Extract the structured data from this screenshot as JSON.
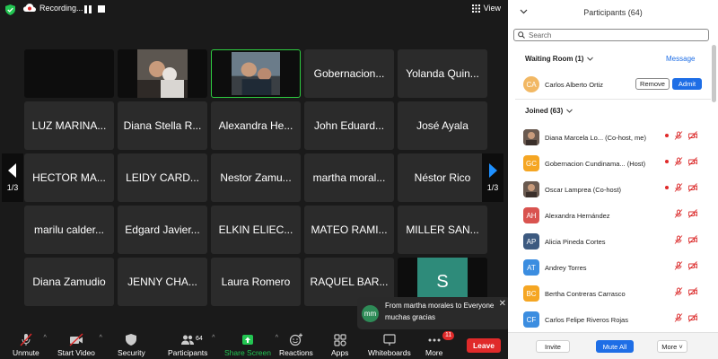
{
  "topbar": {
    "recording_label": "Recording...",
    "view_label": "View"
  },
  "tiles": [
    {
      "type": "dark",
      "name": ""
    },
    {
      "type": "photo",
      "name": ""
    },
    {
      "type": "photo-active",
      "name": ""
    },
    {
      "type": "name",
      "name": "Gobernacion..."
    },
    {
      "type": "name",
      "name": "Yolanda Quin..."
    },
    {
      "type": "name",
      "name": "LUZ MARINA..."
    },
    {
      "type": "name",
      "name": "Diana Stella R..."
    },
    {
      "type": "name",
      "name": "Alexandra He..."
    },
    {
      "type": "name",
      "name": "John Eduard..."
    },
    {
      "type": "name",
      "name": "José Ayala"
    },
    {
      "type": "name",
      "name": "HECTOR MA..."
    },
    {
      "type": "name",
      "name": "LEIDY CARD..."
    },
    {
      "type": "name",
      "name": "Nestor Zamu..."
    },
    {
      "type": "name",
      "name": "martha moral..."
    },
    {
      "type": "name",
      "name": "Néstor Rico"
    },
    {
      "type": "name",
      "name": "marilu calder..."
    },
    {
      "type": "name",
      "name": "Edgard Javier..."
    },
    {
      "type": "name",
      "name": "ELKIN ELIEC..."
    },
    {
      "type": "name",
      "name": "MATEO RAMI..."
    },
    {
      "type": "name",
      "name": "MILLER SAN..."
    },
    {
      "type": "name",
      "name": "Diana Zamudio"
    },
    {
      "type": "name",
      "name": "JENNY CHA..."
    },
    {
      "type": "name",
      "name": "Laura Romero"
    },
    {
      "type": "name",
      "name": "RAQUEL BAR..."
    },
    {
      "type": "letter",
      "name": "S",
      "color": "#2e8b7a"
    }
  ],
  "pager": {
    "left_label": "1/3",
    "right_label": "1/3",
    "arrow_color": "#1e90ff"
  },
  "toast": {
    "avatar_initials": "mm",
    "title": "From martha morales to Everyone",
    "message": "muchas gracias"
  },
  "toolbar": {
    "unmute": "Unmute",
    "start_video": "Start Video",
    "security": "Security",
    "participants": "Participants",
    "participants_count": "64",
    "share_screen": "Share Screen",
    "reactions": "Reactions",
    "apps": "Apps",
    "whiteboards": "Whiteboards",
    "more": "More",
    "more_badge": "11",
    "leave": "Leave"
  },
  "panel": {
    "title": "Participants (64)",
    "search_placeholder": "Search",
    "waiting_room_label": "Waiting Room (1)",
    "message_link": "Message",
    "waiting": {
      "initials": "CA",
      "name": "Carlos Alberto Ortiz",
      "color": "#f2b864"
    },
    "remove_label": "Remove",
    "admit_label": "Admit",
    "joined_label": "Joined (63)",
    "participants": [
      {
        "initials": "",
        "avatar": "photo",
        "name": "Diana Marcela Lo... (Co-host, me)",
        "recording": true
      },
      {
        "initials": "GC",
        "color": "#f5a623",
        "name": "Gobernacion Cundinama... (Host)",
        "recording": true
      },
      {
        "initials": "",
        "avatar": "photo",
        "name": "Oscar Lamprea (Co-host)",
        "recording": true
      },
      {
        "initials": "AH",
        "color": "#d9534f",
        "name": "Alexandra Hernández",
        "recording": false
      },
      {
        "initials": "AP",
        "color": "#3d5a80",
        "name": "Alicia Pineda Cortes",
        "recording": false
      },
      {
        "initials": "AT",
        "color": "#3b8de0",
        "name": "Andrey Torres",
        "recording": false
      },
      {
        "initials": "BC",
        "color": "#f5a623",
        "name": "Bertha Contreras Carrasco",
        "recording": false
      },
      {
        "initials": "CF",
        "color": "#3b8de0",
        "name": "Carlos Felipe Riveros Rojas",
        "recording": false
      }
    ],
    "invite_label": "Invite",
    "mute_all_label": "Mute All",
    "more_label": "More"
  }
}
